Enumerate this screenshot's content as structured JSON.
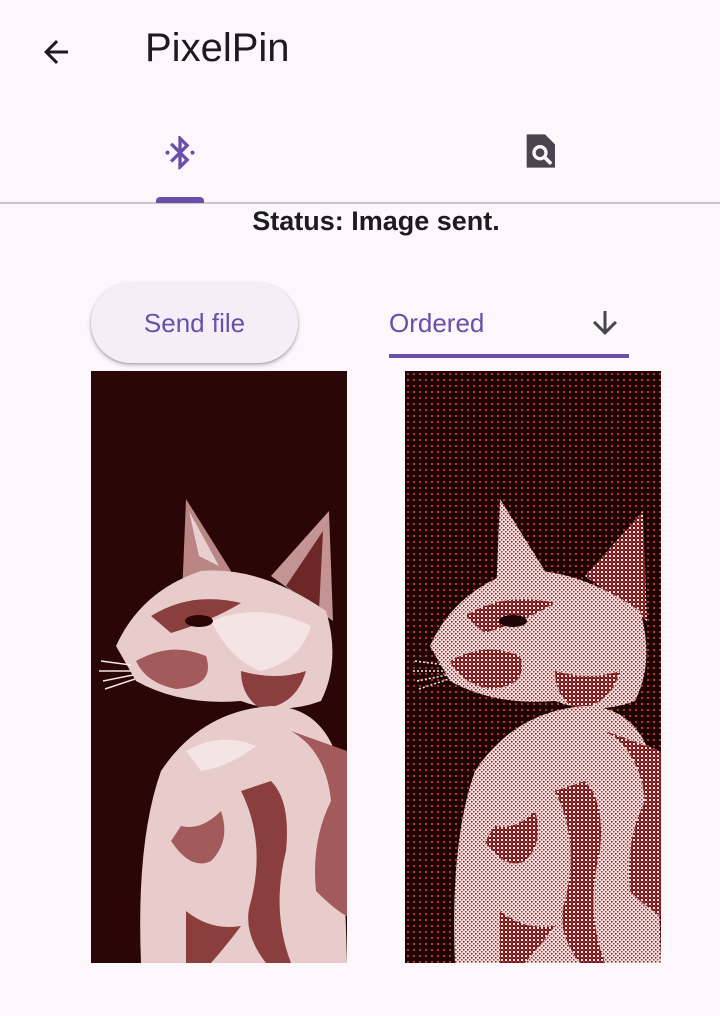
{
  "app": {
    "title": "PixelPin"
  },
  "icons": {
    "back": "arrow-back-icon",
    "bluetooth": "bluetooth-searching-icon",
    "preview": "find-in-page-icon",
    "dropdown": "arrow-down-icon"
  },
  "tabs": [
    {
      "name": "bluetooth",
      "icon": "bluetooth-searching-icon",
      "selected": true
    },
    {
      "name": "preview",
      "icon": "find-in-page-icon",
      "selected": false
    }
  ],
  "status": {
    "text": "Status: Image sent."
  },
  "actions": {
    "send_label": "Send file"
  },
  "dither": {
    "selected": "Ordered"
  },
  "images": {
    "original": "cat-original-image",
    "dithered": "cat-dithered-image"
  },
  "colors": {
    "accent": "#6a4fa8",
    "background": "#fdf6fb",
    "image_dark": "#2a0606",
    "image_light": "#f6e6e6",
    "image_mid": "#a35a5a"
  }
}
